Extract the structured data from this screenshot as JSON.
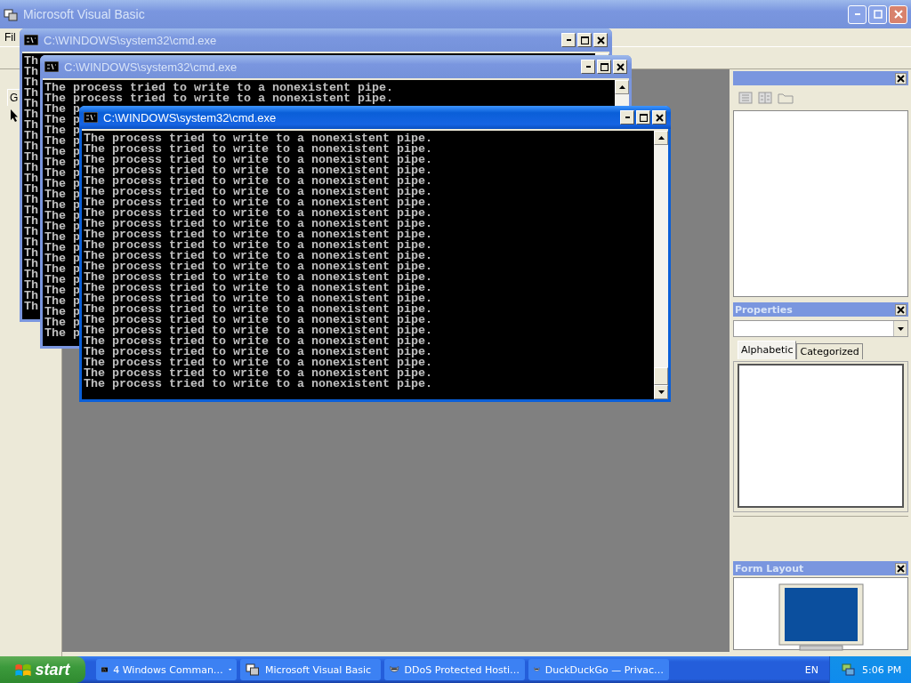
{
  "ide": {
    "title": "Microsoft Visual Basic",
    "menu": [
      "Fil"
    ],
    "toolbox_tab": "G",
    "properties": {
      "title": "Properties",
      "tabs": [
        {
          "label": "Alphabetic",
          "selected": true
        },
        {
          "label": "Categorized",
          "selected": false
        }
      ]
    },
    "form_layout": {
      "title": "Form Layout"
    }
  },
  "consoles": [
    {
      "title": "C:\\WINDOWS\\system32\\cmd.exe",
      "active": false,
      "lines": [
        "Th",
        "Th",
        "Th",
        "Th",
        "Th",
        "Th",
        "Th",
        "Th",
        "Th",
        "Th",
        "Th",
        "Th",
        "Th",
        "Th",
        "Th",
        "Th",
        "Th",
        "Th",
        "Th",
        "Th",
        "Th",
        "Th",
        "Th",
        "Th"
      ]
    },
    {
      "title": "C:\\WINDOWS\\system32\\cmd.exe",
      "active": false,
      "lines": [
        "The process tried to write to a nonexistent pipe.",
        "The process tried to write to a nonexistent pipe.",
        "The p",
        "The p",
        "The p",
        "The p",
        "The p",
        "The p",
        "The p",
        "The p",
        "The p",
        "The p",
        "The p",
        "The p",
        "The p",
        "The p",
        "The p",
        "The p",
        "The p",
        "The p",
        "The p",
        "The p",
        "The p",
        "The p"
      ]
    },
    {
      "title": "C:\\WINDOWS\\system32\\cmd.exe",
      "active": true,
      "lines": [
        "The process tried to write to a nonexistent pipe.",
        "The process tried to write to a nonexistent pipe.",
        "The process tried to write to a nonexistent pipe.",
        "The process tried to write to a nonexistent pipe.",
        "The process tried to write to a nonexistent pipe.",
        "The process tried to write to a nonexistent pipe.",
        "The process tried to write to a nonexistent pipe.",
        "The process tried to write to a nonexistent pipe.",
        "The process tried to write to a nonexistent pipe.",
        "The process tried to write to a nonexistent pipe.",
        "The process tried to write to a nonexistent pipe.",
        "The process tried to write to a nonexistent pipe.",
        "The process tried to write to a nonexistent pipe.",
        "The process tried to write to a nonexistent pipe.",
        "The process tried to write to a nonexistent pipe.",
        "The process tried to write to a nonexistent pipe.",
        "The process tried to write to a nonexistent pipe.",
        "The process tried to write to a nonexistent pipe.",
        "The process tried to write to a nonexistent pipe.",
        "The process tried to write to a nonexistent pipe.",
        "The process tried to write to a nonexistent pipe.",
        "The process tried to write to a nonexistent pipe.",
        "The process tried to write to a nonexistent pipe.",
        "The process tried to write to a nonexistent pipe."
      ]
    }
  ],
  "taskbar": {
    "start": "start",
    "buttons": [
      {
        "label": "4 Windows Comman…",
        "group": true
      },
      {
        "label": "Microsoft Visual Basic",
        "group": false
      },
      {
        "label": "DDoS Protected Hosti…",
        "group": false
      },
      {
        "label": "DuckDuckGo — Privac…",
        "group": false
      }
    ],
    "language": "EN",
    "clock": "5:06 PM"
  }
}
